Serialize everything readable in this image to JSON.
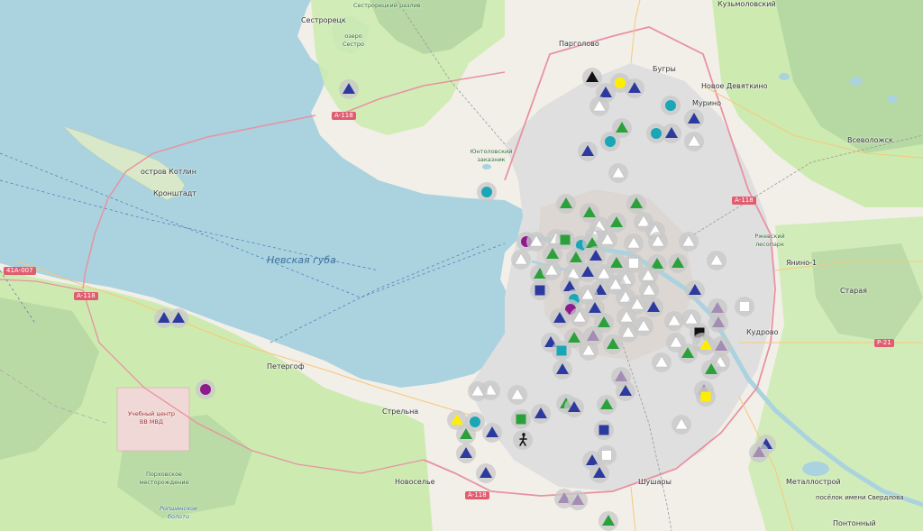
{
  "map": {
    "place_labels": [
      {
        "name": "label-sestroretsk",
        "text": "Сестрорецк",
        "cls": "place"
      },
      {
        "name": "label-sestroretsky-razliv",
        "text": "Сестрорецкий разлив",
        "cls": "small"
      },
      {
        "name": "label-pargolovo",
        "text": "Парголово",
        "cls": "place"
      },
      {
        "name": "label-bugry",
        "text": "Бугры",
        "cls": "place"
      },
      {
        "name": "label-kuzmolovsky",
        "text": "Кузьмоловский",
        "cls": "place"
      },
      {
        "name": "label-novoe-devyatkino",
        "text": "Новое Девяткино",
        "cls": "place"
      },
      {
        "name": "label-murino",
        "text": "Мурино",
        "cls": "place"
      },
      {
        "name": "label-vsevolozhsk",
        "text": "Всеволожск",
        "cls": "place"
      },
      {
        "name": "label-ostrov-kotlin",
        "text": "остров Котлин",
        "cls": "place"
      },
      {
        "name": "label-kronshtadt",
        "text": "Кронштадт",
        "cls": "place"
      },
      {
        "name": "label-nevskaya-guba",
        "text": "Невская губа",
        "cls": "water"
      },
      {
        "name": "label-yanino",
        "text": "Янино-1",
        "cls": "place"
      },
      {
        "name": "label-staraya",
        "text": "Старая",
        "cls": "place"
      },
      {
        "name": "label-kudrovo",
        "text": "Кудрово",
        "cls": "place"
      },
      {
        "name": "label-petergof",
        "text": "Петергоф",
        "cls": "place"
      },
      {
        "name": "label-strelna",
        "text": "Стрельна",
        "cls": "place"
      },
      {
        "name": "label-novoselye",
        "text": "Новоселье",
        "cls": "place"
      },
      {
        "name": "label-shushary",
        "text": "Шушары",
        "cls": "place"
      },
      {
        "name": "label-metallostroy",
        "text": "Металлострой",
        "cls": "place"
      },
      {
        "name": "label-sverdlova",
        "text": "посёлок имени Свердлова",
        "cls": "place"
      },
      {
        "name": "label-pontonny",
        "text": "Понтонный",
        "cls": "place"
      },
      {
        "name": "label-uchebny-tsentr",
        "text": "Учебный центр ВВ МВД",
        "cls": "red"
      },
      {
        "name": "label-mestorozhdenie",
        "text": "Порховское месторождение",
        "cls": "small"
      },
      {
        "name": "label-ropshinskoye",
        "text": "Ропшинское болото",
        "cls": "italic"
      },
      {
        "name": "label-yuntolovsky",
        "text": "Юнтоловский заказник",
        "cls": "small"
      },
      {
        "name": "label-rzhevsky",
        "text": "Ржевский лесопарк",
        "cls": "small"
      },
      {
        "name": "label-ozero-sestro",
        "text": "озеро Сестро",
        "cls": "small"
      }
    ],
    "road_shields": [
      {
        "name": "shield-a118-north",
        "text": "А-118"
      },
      {
        "name": "shield-a118-east",
        "text": "А-118"
      },
      {
        "name": "shield-a118-west",
        "text": "А-118"
      },
      {
        "name": "shield-a118-south",
        "text": "А-118"
      },
      {
        "name": "shield-41a007",
        "text": "41А-007"
      },
      {
        "name": "shield-r21",
        "text": "Р-21"
      }
    ],
    "colors": {
      "water": "#aad3df",
      "land": "#f2efe9",
      "forest": "#add19e",
      "grass": "#cdebb0",
      "urban": "#e0dfdf",
      "motorway": "#e892a2",
      "marker_halo": "#c8c8c8",
      "blue": "#2c3aa0",
      "green": "#2aa13a",
      "teal": "#1aa6b7",
      "yellow": "#ffee00",
      "purple": "#8e1b8e",
      "lavender": "#a48cb4",
      "black": "#111111",
      "white": "#ffffff"
    },
    "marker_icons": [
      "blue-triangle-icon",
      "green-triangle-icon",
      "white-triangle-icon",
      "lavender-triangle-icon",
      "black-triangle-icon",
      "yellow-triangle-icon",
      "teal-circle-icon",
      "yellow-circle-icon",
      "purple-circle-icon",
      "blue-square-icon",
      "green-square-icon",
      "yellow-square-icon",
      "black-square-icon",
      "white-square-icon",
      "pedestrian-icon"
    ]
  }
}
